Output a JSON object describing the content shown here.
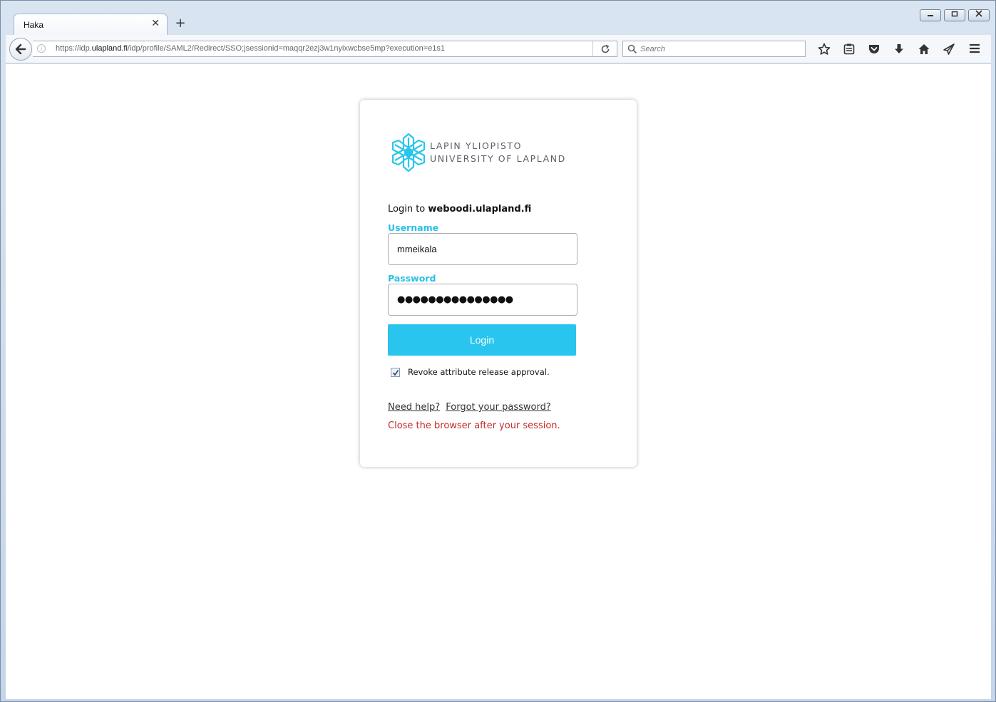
{
  "browser": {
    "tab_title": "Haka",
    "tab_close": "✕",
    "new_tab": "+",
    "url_prefix": "https://idp.",
    "url_domain": "ulapland.fi",
    "url_suffix": "/idp/profile/SAML2/Redirect/SSO;jsessionid=maqqr2ezj3w1nyixwcbse5mp?execution=e1s1",
    "search_placeholder": "Search",
    "window_controls": [
      "minimize",
      "restore",
      "close"
    ]
  },
  "logo": {
    "line1": "LAPIN YLIOPISTO",
    "line2": "UNIVERSITY OF LAPLAND",
    "color": "#29c5ee"
  },
  "login": {
    "intro": "Login to ",
    "service": "weboodi.ulapland.fi",
    "username_label": "Username",
    "username_value": "mmeikala",
    "password_label": "Password",
    "password_dots": "●●●●●●●●●●●●●●●",
    "button_label": "Login",
    "revoke_label": "Revoke attribute release approval.",
    "revoke_checked": true,
    "help_link": "Need help?",
    "forgot_link": "Forgot your password?",
    "warning": "Close the browser after your session."
  },
  "colors": {
    "accent": "#29c5ee",
    "label": "#27c1e6",
    "warning": "#c62a2a"
  }
}
